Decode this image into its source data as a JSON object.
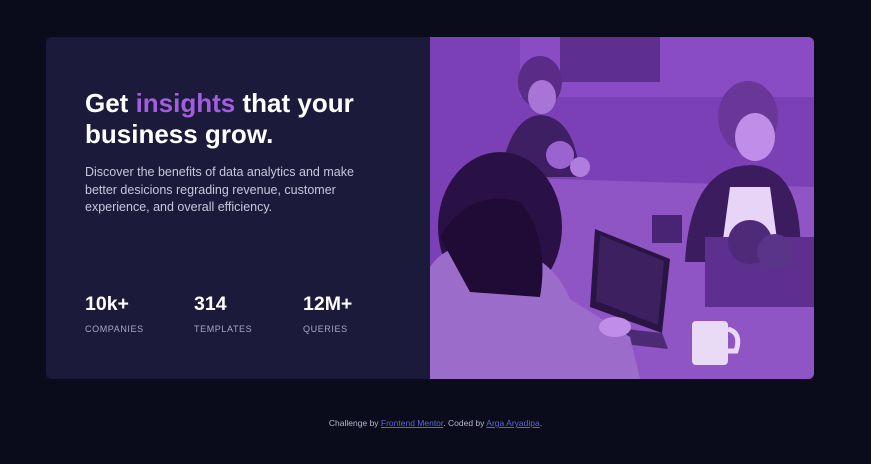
{
  "hero": {
    "headline_before": "Get ",
    "headline_accent": "insights",
    "headline_after": " that your business grow.",
    "description": "Discover the benefits of data analytics and make better desicions regrading revenue, customer experience, and overall efficiency."
  },
  "stats": [
    {
      "value": "10k+",
      "label": "COMPANIES"
    },
    {
      "value": "314",
      "label": "TEMPLATES"
    },
    {
      "value": "12M+",
      "label": "QUERIES"
    }
  ],
  "footer": {
    "prefix": "Challenge by ",
    "link1": "Frontend Mentor",
    "middle": ". Coded by ",
    "link2": "Arga Aryadipa",
    "suffix": "."
  },
  "colors": {
    "background": "#0a0c1c",
    "card": "#1b1a3a",
    "accent": "#a35de0",
    "photo_tint": "#7a3fb5",
    "link": "#5a66d6"
  }
}
